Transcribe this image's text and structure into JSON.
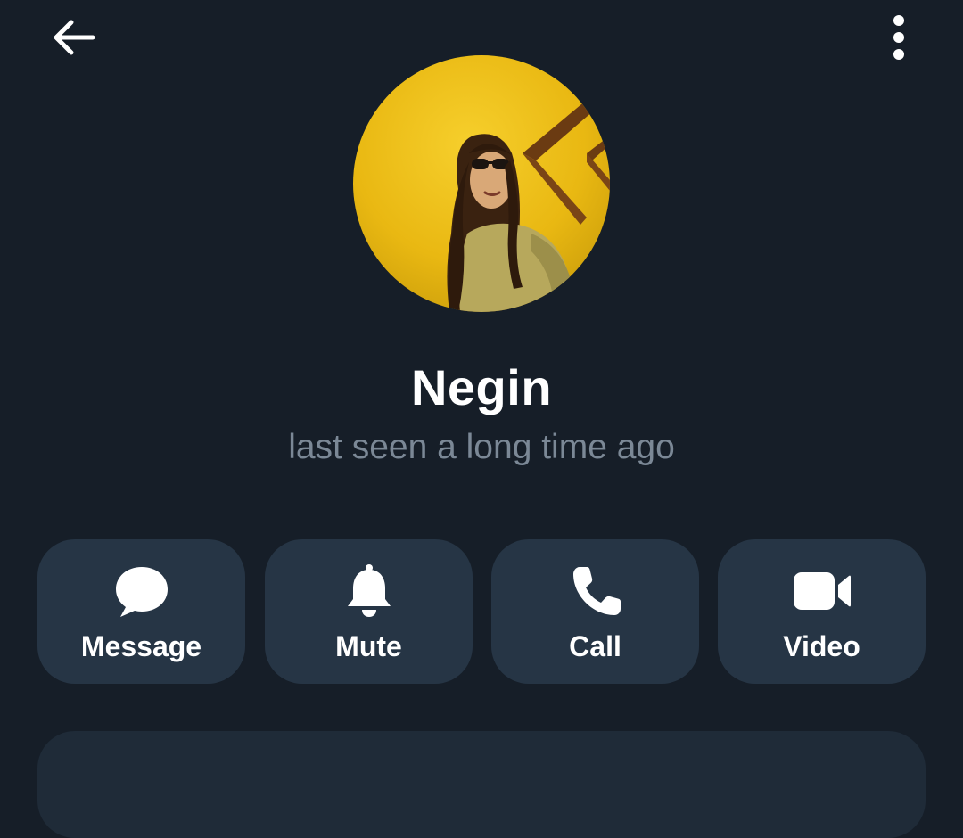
{
  "profile": {
    "name": "Negin",
    "status": "last seen a long time ago"
  },
  "header": {
    "back_icon": "arrow-left-icon",
    "menu_icon": "more-vertical-icon"
  },
  "actions": [
    {
      "label": "Message",
      "icon": "chat-bubble-icon"
    },
    {
      "label": "Mute",
      "icon": "bell-icon"
    },
    {
      "label": "Call",
      "icon": "phone-icon"
    },
    {
      "label": "Video",
      "icon": "video-camera-icon"
    }
  ],
  "colors": {
    "background": "#161e28",
    "button_background": "#263545",
    "status_text": "#7b8896",
    "avatar_accent": "#f2c014"
  }
}
